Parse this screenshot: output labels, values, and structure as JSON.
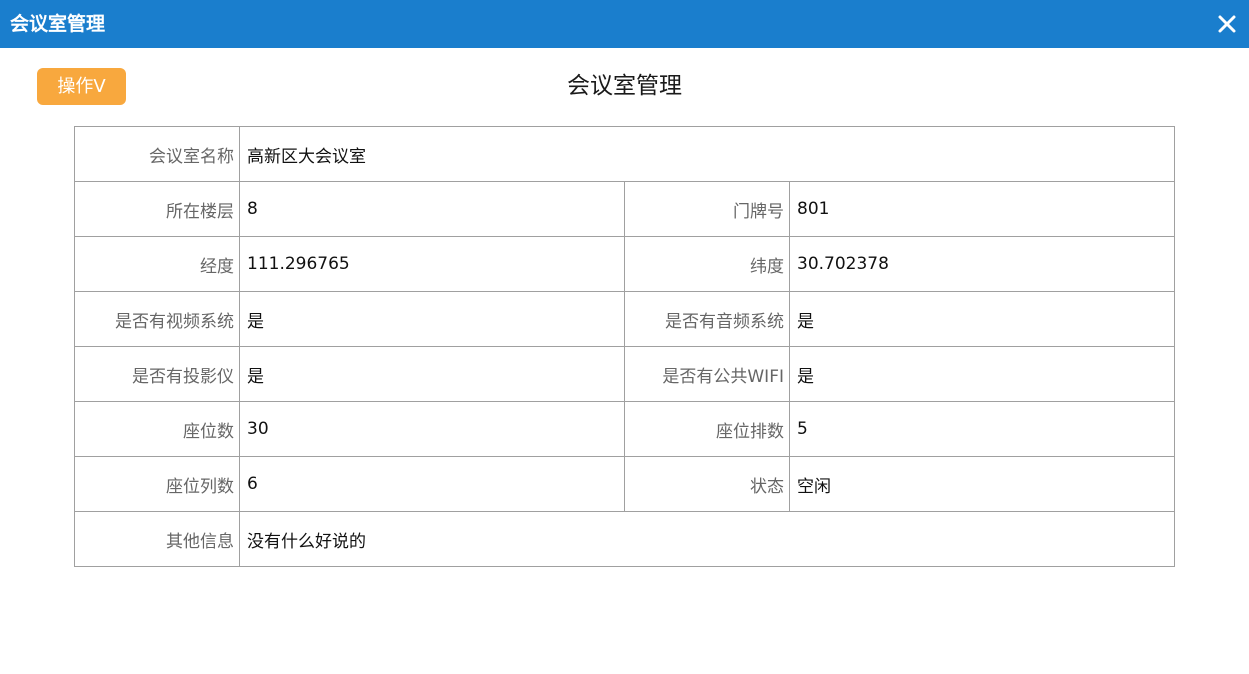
{
  "titlebar": {
    "title": "会议室管理",
    "close_icon": "close-icon"
  },
  "toolbar": {
    "operate_label": "操作V"
  },
  "page": {
    "heading": "会议室管理"
  },
  "colors": {
    "titlebar": "#1a7ecd",
    "operate_button": "#f8a83e",
    "border": "#a0a0a0",
    "label_text": "#666666"
  },
  "fields": {
    "name": {
      "label": "会议室名称",
      "value": "高新区大会议室"
    },
    "floor": {
      "label": "所在楼层",
      "value": "8"
    },
    "door_no": {
      "label": "门牌号",
      "value": "801"
    },
    "longitude": {
      "label": "经度",
      "value": "111.296765"
    },
    "latitude": {
      "label": "纬度",
      "value": "30.702378"
    },
    "video": {
      "label": "是否有视频系统",
      "value": "是"
    },
    "audio": {
      "label": "是否有音频系统",
      "value": "是"
    },
    "projector": {
      "label": "是否有投影仪",
      "value": "是"
    },
    "wifi": {
      "label": "是否有公共WIFI",
      "value": "是"
    },
    "seats": {
      "label": "座位数",
      "value": "30"
    },
    "seat_rows": {
      "label": "座位排数",
      "value": "5"
    },
    "seat_cols": {
      "label": "座位列数",
      "value": "6"
    },
    "status": {
      "label": "状态",
      "value": "空闲"
    },
    "other": {
      "label": "其他信息",
      "value": "没有什么好说的"
    }
  }
}
